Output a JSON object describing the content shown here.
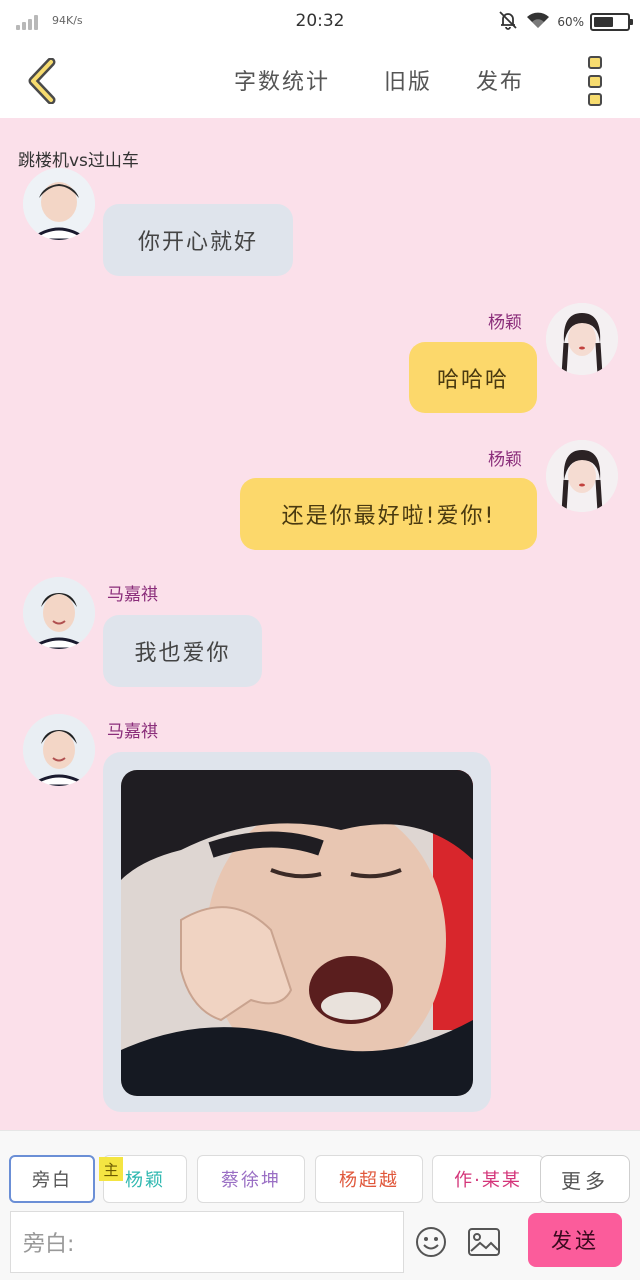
{
  "status_bar": {
    "net_speed": "94K/s",
    "time": "20:32",
    "battery_percent": "60%",
    "battery_level": 0.6,
    "icons": [
      "signal-icon",
      "mute-bell-icon",
      "wifi-icon",
      "battery-icon"
    ]
  },
  "app_bar": {
    "back_icon": "chevron-left-icon",
    "links": [
      "字数统计",
      "旧版",
      "发布"
    ],
    "more_icon": "vertical-dots-icon"
  },
  "chat": {
    "room_title": "跳楼机vs过山车",
    "messages": [
      {
        "side": "left",
        "sender": "",
        "type": "text",
        "text": "你开心就好"
      },
      {
        "side": "right",
        "sender": "杨颖",
        "type": "text",
        "text": "哈哈哈"
      },
      {
        "side": "right",
        "sender": "杨颖",
        "type": "text",
        "text": "还是你最好啦!爱你!"
      },
      {
        "side": "left",
        "sender": "马嘉祺",
        "type": "text",
        "text": "我也爱你"
      },
      {
        "side": "left",
        "sender": "马嘉祺",
        "type": "image",
        "text": ""
      }
    ]
  },
  "composer": {
    "role_chips": [
      {
        "label": "旁白",
        "color": "#555555",
        "selected": true
      },
      {
        "label": "杨颖",
        "color": "#2fb8b0",
        "selected": false
      },
      {
        "label": "蔡徐坤",
        "color": "#9a6fc4",
        "selected": false
      },
      {
        "label": "杨超越",
        "color": "#e0583c",
        "selected": false
      },
      {
        "label": "作·某某",
        "color": "#d4367a",
        "selected": false
      }
    ],
    "owner_badge": "主",
    "more_label": "更多",
    "input_placeholder": "旁白:",
    "emoji_icon": "smiley-icon",
    "image_icon": "image-icon",
    "send_label": "发送",
    "colors": {
      "send": "#fb5c9b",
      "bubble_right": "#fcd86b",
      "bubble_left": "#dfe4ec",
      "background": "#fbe0ea"
    }
  }
}
